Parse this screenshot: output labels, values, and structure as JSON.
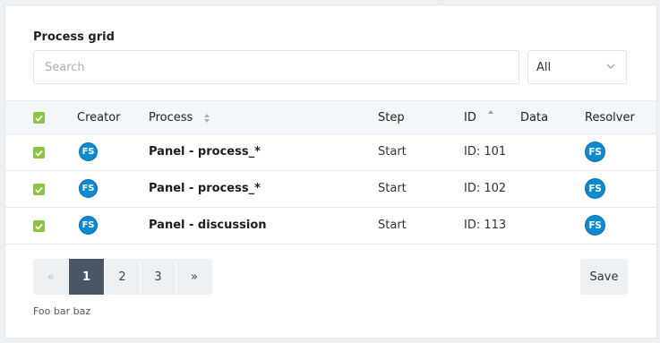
{
  "grid": {
    "title": "Process grid",
    "search_placeholder": "Search",
    "filter": {
      "selected": "All"
    }
  },
  "table": {
    "header": {
      "select_all_checked": true
    },
    "columns": [
      "Creator",
      "Process",
      "Step",
      "ID",
      "Data",
      "Resolver"
    ],
    "rows": [
      {
        "checked": true,
        "creator": "FS",
        "process": "Panel - process_*",
        "step": "Start",
        "id": "ID: 101",
        "data": "",
        "resolver": "FS"
      },
      {
        "checked": true,
        "creator": "FS",
        "process": "Panel - process_*",
        "step": "Start",
        "id": "ID: 102",
        "data": "",
        "resolver": "FS"
      },
      {
        "checked": true,
        "creator": "FS",
        "process": "Panel - discussion",
        "step": "Start",
        "id": "ID: 113",
        "data": "",
        "resolver": "FS"
      }
    ]
  },
  "pagination": {
    "prev": "«",
    "pages": [
      "1",
      "2",
      "3"
    ],
    "active_page": "1",
    "next": "»"
  },
  "actions": {
    "save_label": "Save"
  },
  "footer": {
    "text": "Foo bar baz"
  },
  "colors": {
    "checkbox": "#8cc63f",
    "avatar": "#0e8ad1",
    "active_page": "#4a5565"
  }
}
